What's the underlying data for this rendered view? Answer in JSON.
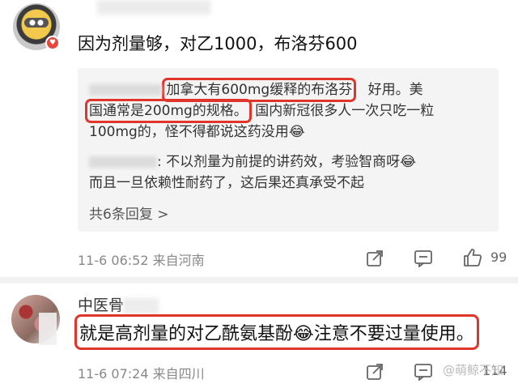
{
  "comment1": {
    "vip_badge": "♥",
    "text": "因为剂量够，对乙1000，布洛芬600",
    "replies": {
      "line1_highlight": "加拿大有600mg缓释的布洛芬",
      "line1_tail": "好用。美",
      "line2_highlight": "国通常是200mg的规格。",
      "line2_tail": "国内新冠很多人一次只吃一粒",
      "line3": "100mg的，怪不得都说这药没用",
      "line3_emoji": "😂",
      "line4": ": 不以剂量为前提的讲药效，考验智商呀",
      "line4_emoji": "😂",
      "line5": "而且一旦依赖性耐药了，这后果还真承受不起",
      "more": "共6条回复 >"
    },
    "meta": "11-6 06:52 来自河南",
    "likes": "99"
  },
  "comment2": {
    "username": "中医骨",
    "text_before": "就是高剂量的对乙酰氨基酚",
    "emoji": "😂",
    "text_after": "注意不要过量使用。",
    "meta": "11-6 07:24 来自四川",
    "likes": "114"
  },
  "watermark": "@萌鲸不知",
  "icons": [
    "share-icon",
    "comment-icon",
    "like-icon"
  ],
  "colors": {
    "highlight": "#e0352b",
    "meta": "#888888",
    "reply_bg": "#f4f4f4"
  }
}
